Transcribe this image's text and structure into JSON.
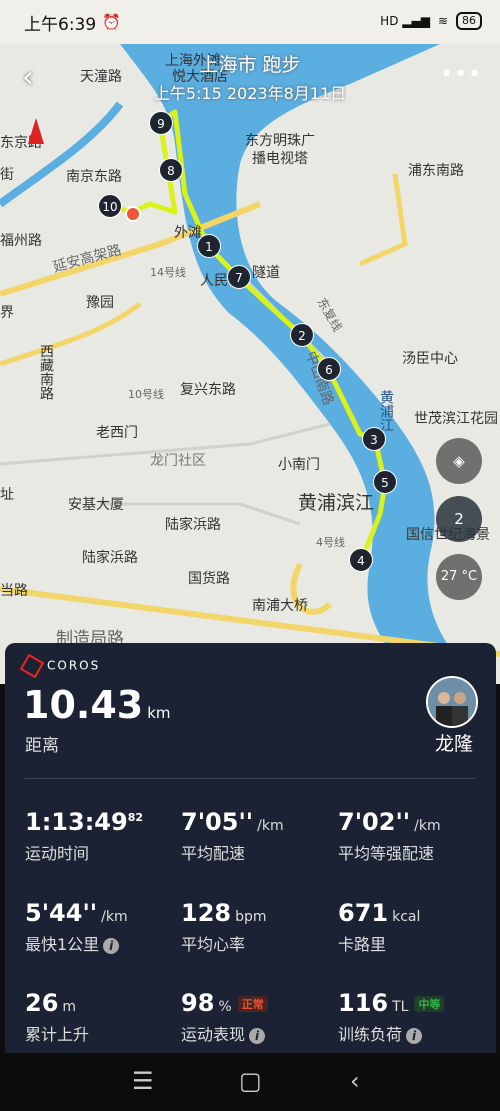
{
  "status_bar": {
    "time": "上午6:39",
    "alarm_icon": "alarm-icon",
    "signal_text": "HD",
    "battery": "86"
  },
  "header": {
    "title": "上海市 跑步",
    "subtitle": "上午5:15 2023年8月11日"
  },
  "map": {
    "labels": [
      "天潼路",
      "上海外滩",
      "悦大酒店",
      "东方明珠广",
      "播电视塔",
      "浦东南路",
      "南京东路",
      "福州路",
      "延安高架路",
      "外滩",
      "人民",
      "隧道",
      "豫园",
      "14号线",
      "东复线",
      "汤臣中心",
      "西藏南路",
      "复兴东路",
      "10号线",
      "老西门",
      "黄浦江",
      "世茂滨江花园",
      "龙门社区",
      "小南门",
      "黄浦滨江",
      "安基大厦",
      "陆家浜路",
      "陆家浜路",
      "4号线",
      "国信世纪海景",
      "国货路",
      "南浦大桥",
      "制造局路",
      "中山南路",
      "东京路",
      "街",
      "当路",
      "界",
      "址"
    ],
    "markers": [
      "9",
      "8",
      "10",
      "1",
      "7",
      "2",
      "6",
      "3",
      "5",
      "4"
    ],
    "compass_value": "2",
    "temperature": "27 °C",
    "route_color": "#d9f21a",
    "water_color": "#5aaee0"
  },
  "panel": {
    "brand": "COROS",
    "distance": {
      "value": "10.43",
      "unit": "km",
      "label": "距离"
    },
    "user_name": "龙隆",
    "stats": [
      {
        "value": "1:13:49",
        "sup": "82",
        "unit": "",
        "label": "运动时间"
      },
      {
        "value": "7'05''",
        "unit": "/km",
        "label": "平均配速"
      },
      {
        "value": "7'02''",
        "unit": "/km",
        "label": "平均等强配速"
      },
      {
        "value": "5'44''",
        "unit": "/km",
        "label": "最快1公里",
        "info": true
      },
      {
        "value": "128",
        "unit": "bpm",
        "label": "平均心率"
      },
      {
        "value": "671",
        "unit": "kcal",
        "label": "卡路里"
      },
      {
        "value": "26",
        "unit": "m",
        "label": "累计上升"
      },
      {
        "value": "98",
        "unit": "%",
        "badge": "正常",
        "badge_color": "#e0553a",
        "label": "运动表现",
        "info": true
      },
      {
        "value": "116",
        "unit": "TL",
        "badge": "中等",
        "badge_color": "#36b04a",
        "label": "训练负荷",
        "info": true
      }
    ]
  },
  "nav": {
    "menu_icon": "menu-icon",
    "home_icon": "home-icon",
    "back_icon": "back-icon"
  }
}
